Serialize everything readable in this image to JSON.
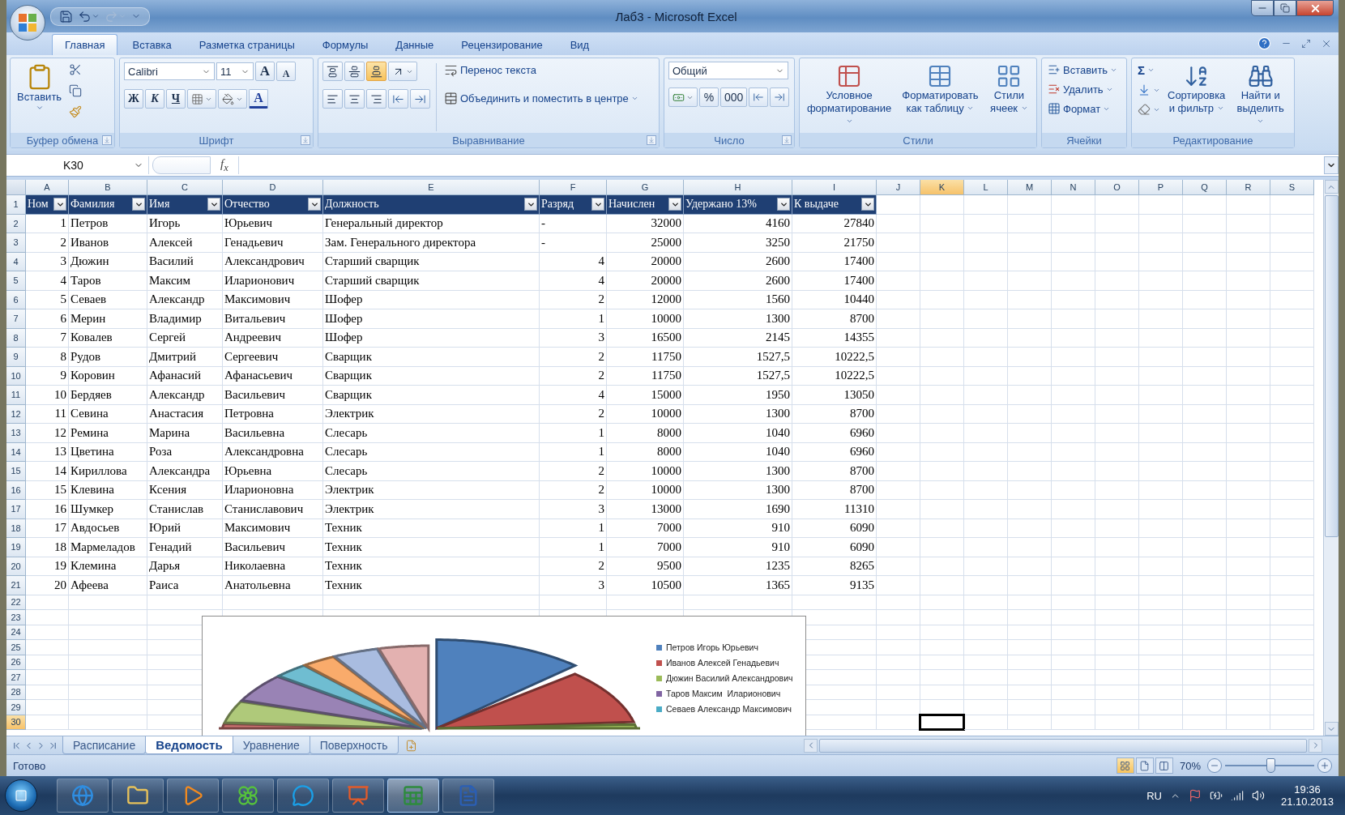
{
  "title_bar": {
    "title": "Лаб3 - Microsoft Excel"
  },
  "ribbon_tabs": [
    {
      "label": "Главная",
      "selected": true
    },
    {
      "label": "Вставка",
      "selected": false
    },
    {
      "label": "Разметка страницы",
      "selected": false
    },
    {
      "label": "Формулы",
      "selected": false
    },
    {
      "label": "Данные",
      "selected": false
    },
    {
      "label": "Рецензирование",
      "selected": false
    },
    {
      "label": "Вид",
      "selected": false
    }
  ],
  "ribbon": {
    "clipboard": {
      "paste": "Вставить",
      "label": "Буфер обмена"
    },
    "font": {
      "font_name": "Calibri",
      "font_size": "11",
      "grow": "A",
      "shrink": "A",
      "bold": "Ж",
      "italic": "К",
      "underline": "Ч",
      "font_color": "A",
      "label": "Шрифт"
    },
    "alignment": {
      "vertical": [
        {
          "kind": "top",
          "selected": false
        },
        {
          "kind": "middle",
          "selected": false
        },
        {
          "kind": "bottom",
          "selected": true
        }
      ],
      "wrap_text": "Перенос текста",
      "merge": "Объединить и поместить в центре",
      "label": "Выравнивание"
    },
    "number": {
      "format": "Общий",
      "percent": "%",
      "thousands": "000",
      "label": "Число"
    },
    "styles": {
      "buttons": [
        "Условное форматирование",
        "Форматировать как таблицу",
        "Стили ячеек"
      ],
      "label": "Стили"
    },
    "cells": {
      "buttons": [
        "Вставить",
        "Удалить",
        "Формат"
      ],
      "label": "Ячейки"
    },
    "editing": {
      "sum": "Σ",
      "buttons": [
        "Сортировка и фильтр",
        "Найти и выделить"
      ],
      "label": "Редактирование"
    }
  },
  "formula_bar": {
    "name_box": "K30",
    "fx": "f$_{x}$"
  },
  "columns": [
    {
      "label": "A",
      "selected": false
    },
    {
      "label": "B",
      "selected": false
    },
    {
      "label": "C",
      "selected": false
    },
    {
      "label": "D",
      "selected": false
    },
    {
      "label": "E",
      "selected": false
    },
    {
      "label": "F",
      "selected": false
    },
    {
      "label": "G",
      "selected": false
    },
    {
      "label": "H",
      "selected": false
    },
    {
      "label": "I",
      "selected": false
    },
    {
      "label": "J",
      "selected": false
    },
    {
      "label": "K",
      "selected": true
    },
    {
      "label": "L",
      "selected": false
    },
    {
      "label": "M",
      "selected": false
    },
    {
      "label": "N",
      "selected": false
    },
    {
      "label": "O",
      "selected": false
    },
    {
      "label": "P",
      "selected": false
    },
    {
      "label": "Q",
      "selected": false
    },
    {
      "label": "R",
      "selected": false
    },
    {
      "label": "S",
      "selected": false
    }
  ],
  "row_headers": [
    {
      "label": "1",
      "selected": false
    },
    {
      "label": "2",
      "selected": false
    },
    {
      "label": "3",
      "selected": false
    },
    {
      "label": "4",
      "selected": false
    },
    {
      "label": "5",
      "selected": false
    },
    {
      "label": "6",
      "selected": false
    },
    {
      "label": "7",
      "selected": false
    },
    {
      "label": "8",
      "selected": false
    },
    {
      "label": "9",
      "selected": false
    },
    {
      "label": "10",
      "selected": false
    },
    {
      "label": "11",
      "selected": false
    },
    {
      "label": "12",
      "selected": false
    },
    {
      "label": "13",
      "selected": false
    },
    {
      "label": "14",
      "selected": false
    },
    {
      "label": "15",
      "selected": false
    },
    {
      "label": "16",
      "selected": false
    },
    {
      "label": "17",
      "selected": false
    },
    {
      "label": "18",
      "selected": false
    },
    {
      "label": "19",
      "selected": false
    },
    {
      "label": "20",
      "selected": false
    },
    {
      "label": "21",
      "selected": false
    },
    {
      "label": "22",
      "selected": false
    },
    {
      "label": "23",
      "selected": false
    },
    {
      "label": "24",
      "selected": false
    },
    {
      "label": "25",
      "selected": false
    },
    {
      "label": "26",
      "selected": false
    },
    {
      "label": "27",
      "selected": false
    },
    {
      "label": "28",
      "selected": false
    },
    {
      "label": "29",
      "selected": false
    },
    {
      "label": "30",
      "selected": true
    }
  ],
  "table": {
    "headers": [
      "Ном",
      "Фамилия",
      "Имя",
      "Отчество",
      "Должность",
      "Разряд",
      "Начислен",
      "Удержано 13%",
      "К выдаче"
    ],
    "rows": [
      [
        "1",
        "Петров",
        "Игорь",
        "Юрьевич",
        "Генеральный директор",
        "-",
        "32000",
        "4160",
        "27840"
      ],
      [
        "2",
        "Иванов",
        "Алексей",
        "Генадьевич",
        "Зам. Генерального директора",
        "-",
        "25000",
        "3250",
        "21750"
      ],
      [
        "3",
        "Дюжин",
        "Василий",
        "Александрович",
        "Старший сварщик",
        "4",
        "20000",
        "2600",
        "17400"
      ],
      [
        "4",
        "Таров",
        "Максим",
        "Иларионович",
        "Старший сварщик",
        "4",
        "20000",
        "2600",
        "17400"
      ],
      [
        "5",
        "Севаев",
        "Александр",
        "Максимович",
        "Шофер",
        "2",
        "12000",
        "1560",
        "10440"
      ],
      [
        "6",
        "Мерин",
        "Владимир",
        "Витальевич",
        "Шофер",
        "1",
        "10000",
        "1300",
        "8700"
      ],
      [
        "7",
        "Ковалев",
        "Сергей",
        "Андреевич",
        "Шофер",
        "3",
        "16500",
        "2145",
        "14355"
      ],
      [
        "8",
        "Рудов",
        "Дмитрий",
        "Сергеевич",
        "Сварщик",
        "2",
        "11750",
        "1527,5",
        "10222,5"
      ],
      [
        "9",
        "Коровин",
        "Афанасий",
        "Афанасьевич",
        "Сварщик",
        "2",
        "11750",
        "1527,5",
        "10222,5"
      ],
      [
        "10",
        "Бердяев",
        "Александр",
        "Васильевич",
        "Сварщик",
        "4",
        "15000",
        "1950",
        "13050"
      ],
      [
        "11",
        "Севина",
        "Анастасия",
        "Петровна",
        "Электрик",
        "2",
        "10000",
        "1300",
        "8700"
      ],
      [
        "12",
        "Ремина",
        "Марина",
        "Васильевна",
        "Слесарь",
        "1",
        "8000",
        "1040",
        "6960"
      ],
      [
        "13",
        "Цветина",
        "Роза",
        "Александровна",
        "Слесарь",
        "1",
        "8000",
        "1040",
        "6960"
      ],
      [
        "14",
        "Кириллова",
        "Александра",
        "Юрьевна",
        "Слесарь",
        "2",
        "10000",
        "1300",
        "8700"
      ],
      [
        "15",
        "Клевина",
        "Ксения",
        "Иларионовна",
        "Электрик",
        "2",
        "10000",
        "1300",
        "8700"
      ],
      [
        "16",
        "Шумкер",
        "Станислав",
        "Станиславович",
        "Электрик",
        "3",
        "13000",
        "1690",
        "11310"
      ],
      [
        "17",
        "Авдосьев",
        "Юрий",
        "Максимович",
        "Техник",
        "1",
        "7000",
        "910",
        "6090"
      ],
      [
        "18",
        "Мармеладов",
        "Генадий",
        "Васильевич",
        "Техник",
        "1",
        "7000",
        "910",
        "6090"
      ],
      [
        "19",
        "Клемина",
        "Дарья",
        "Николаевна",
        "Техник",
        "2",
        "9500",
        "1235",
        "8265"
      ],
      [
        "20",
        "Афеева",
        "Раиса",
        "Анатольевна",
        "Техник",
        "3",
        "10500",
        "1365",
        "9135"
      ]
    ]
  },
  "chart": {
    "legend": [
      {
        "label": "Петров Игорь Юрьевич",
        "color": "#4f81bd"
      },
      {
        "label": "Иванов Алексей Генадьевич",
        "color": "#c0504d"
      },
      {
        "label": "Дюжин Василий Александрович",
        "color": "#9bbb59"
      },
      {
        "label": "Таров Максим  Иларионович",
        "color": "#8064a2"
      },
      {
        "label": "Севаев Александр Максимович",
        "color": "#4bacc6"
      }
    ]
  },
  "sheet_tabs": [
    {
      "label": "Расписание",
      "selected": false
    },
    {
      "label": "Ведомость",
      "selected": true
    },
    {
      "label": "Уравнение",
      "selected": false
    },
    {
      "label": "Поверхность",
      "selected": false
    }
  ],
  "status_bar": {
    "status": "Готово",
    "zoom": "70%",
    "zoom_slider": {
      "level": 0.5
    }
  },
  "taskbar": {
    "apps": [
      {
        "kind": "browser",
        "active": false
      },
      {
        "kind": "folder",
        "active": false
      },
      {
        "kind": "media",
        "active": false
      },
      {
        "kind": "flower",
        "active": false
      },
      {
        "kind": "chat",
        "active": false
      },
      {
        "kind": "presentation",
        "active": false
      },
      {
        "kind": "sheet",
        "active": true
      },
      {
        "kind": "document",
        "active": false
      }
    ],
    "language": "RU",
    "time": "19:36",
    "date": "21.10.2013"
  }
}
